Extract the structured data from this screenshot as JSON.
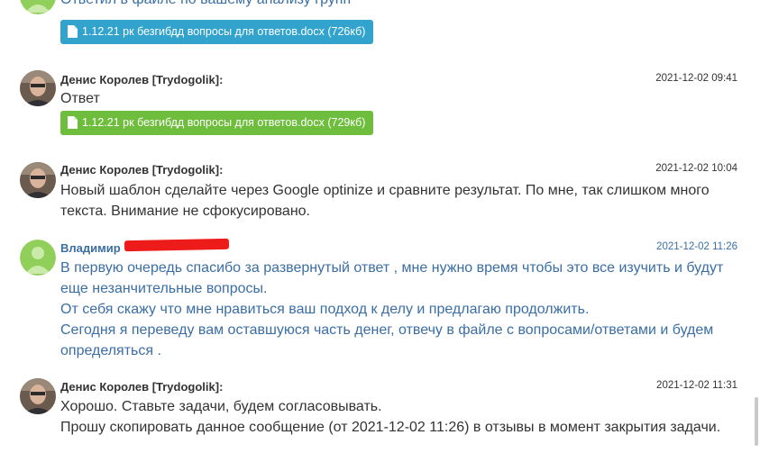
{
  "messages": [
    {
      "text_lines": [
        "Ответил в файле по вашему анализу групп"
      ],
      "file": {
        "label": "1.12.21 рк безгибдд вопросы для ответов.docx (726кб)",
        "color": "#31a3cc"
      }
    },
    {
      "author": "Денис Королев [Trydogolik]:",
      "time": "2021-12-02 09:41",
      "text_lines": [
        "Ответ"
      ],
      "file": {
        "label": "1.12.21 рк безгибдд вопросы для ответов.docx (729кб)",
        "color": "#6fbd3c"
      }
    },
    {
      "author": "Денис Королев [Trydogolik]:",
      "time": "2021-12-02 10:04",
      "text_lines": [
        "Новый шаблон сделайте через Google optinize и сравните результат. По мне, так слишком много",
        "текста. Внимание не сфокусировано."
      ]
    },
    {
      "author": "Владимир",
      "time": "2021-12-02 11:26",
      "text_lines": [
        "В первую очередь спасибо за развернутый ответ , мне нужно время чтобы это все изучить и будут",
        "еще незанчительные вопросы.",
        "От себя скажу что мне нравиться ваш подход к делу и предлагаю продолжить.",
        "Сегодня я переведу вам оставшуюся часть денег, отвечу в файле с вопросами/ответами и будем",
        "определяться ."
      ]
    },
    {
      "author": "Денис Королев [Trydogolik]:",
      "time": "2021-12-02 11:31",
      "text_lines": [
        "Хорошо. Ставьте задачи, будем согласовывать.",
        "Прошу скопировать данное сообщение (от 2021-12-02 11:26) в отзывы в момент закрытия задачи."
      ]
    }
  ],
  "colors": {
    "client_text": "#3a6ea5",
    "staff_text": "#333333",
    "redaction": "#ee1b1b"
  }
}
